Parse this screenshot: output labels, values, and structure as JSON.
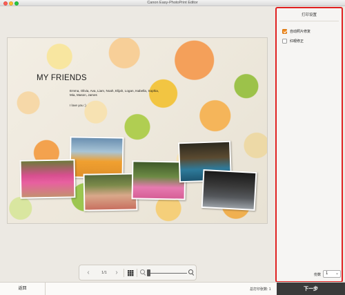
{
  "window": {
    "title": "Canon Easy-PhotoPrint Editor"
  },
  "page": {
    "title": "MY FRIENDS",
    "names": "Emma, Olivia, Ava, Liam, Noah, Elijah, Logan, Isabella, Sophia, Mia, Mason, James",
    "message": "I love you :)"
  },
  "pagenav": {
    "prev": "‹",
    "counter": "1/1",
    "next": "›"
  },
  "settings": {
    "title": "打印设置",
    "options": [
      {
        "label": "自动照片修复",
        "checked": true
      },
      {
        "label": "红眼修正",
        "checked": false
      }
    ],
    "copies_label": "份数",
    "copies_value": "1"
  },
  "bottom": {
    "back_label": "返回",
    "total_label": "总打印张数: 1",
    "next_label": "下一步"
  },
  "colors": {
    "accent": "#f08a1e",
    "highlight_border": "#e02020",
    "next_button": "#3a3a3a"
  }
}
